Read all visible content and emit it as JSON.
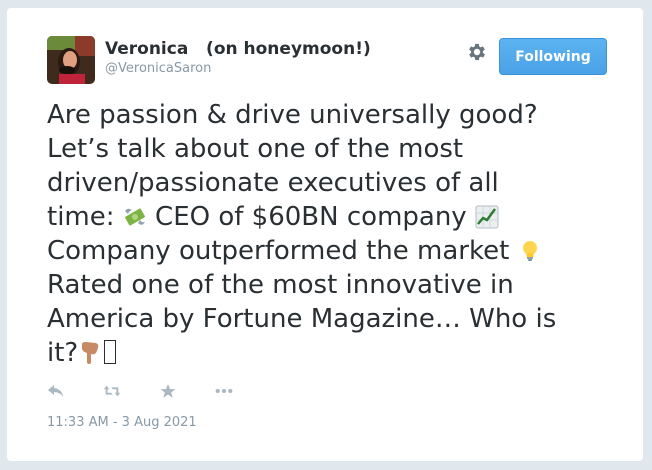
{
  "user": {
    "display_name": "Veronica   (on honeymoon!)",
    "handle": "@VeronicaSaron"
  },
  "follow_button": {
    "label": "Following"
  },
  "tweet": {
    "line1": "Are passion & drive universally good?",
    "line2": "Let’s talk about one of the most",
    "line3": "driven/passionate executives of all",
    "line4a": "time:",
    "line4b": "CEO of $60BN company",
    "line5": "Company outperformed the market",
    "line6": "Rated one of the most innovative in",
    "line7": "America by Fortune Magazine… Who is",
    "line8": "it?"
  },
  "icons": {
    "avatar": "profile-photo",
    "settings": "gear-icon",
    "money": "money-with-wings-emoji",
    "chart": "chart-increasing-emoji",
    "bulb": "light-bulb-emoji",
    "point_down": "backhand-index-pointing-down-emoji",
    "reply": "reply-icon",
    "retweet": "retweet-icon",
    "favorite": "star-icon",
    "more": "more-icon"
  },
  "colors": {
    "accent": "#55acee",
    "text": "#292f33",
    "muted": "#8899a6",
    "action_icon": "#aab8c2"
  },
  "timestamp": "11:33 AM - 3 Aug 2021"
}
